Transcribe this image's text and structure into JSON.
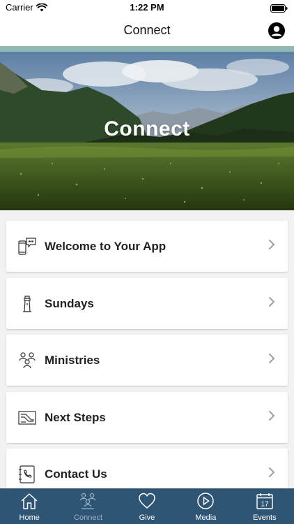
{
  "status_bar": {
    "carrier": "Carrier",
    "time": "1:22 PM"
  },
  "nav": {
    "title": "Connect",
    "profile_icon": "profile-icon"
  },
  "hero": {
    "title": "Connect"
  },
  "list": [
    {
      "label": "Welcome to Your App",
      "icon": "chat-phone-icon"
    },
    {
      "label": "Sundays",
      "icon": "lighthouse-icon"
    },
    {
      "label": "Ministries",
      "icon": "people-group-icon"
    },
    {
      "label": "Next Steps",
      "icon": "steps-icon"
    },
    {
      "label": "Contact Us",
      "icon": "address-book-icon"
    }
  ],
  "tabs": [
    {
      "label": "Home",
      "icon": "home-icon",
      "active": false
    },
    {
      "label": "Connect",
      "icon": "connect-icon",
      "active": true
    },
    {
      "label": "Give",
      "icon": "heart-icon",
      "active": false
    },
    {
      "label": "Media",
      "icon": "play-icon",
      "active": false
    },
    {
      "label": "Events",
      "icon": "calendar-icon",
      "calendar_day": "17",
      "active": false
    }
  ],
  "colors": {
    "accent_strip": "#8fbab4",
    "tab_bar": "#2f5575",
    "active_tab_label": "#9bb3c7"
  }
}
